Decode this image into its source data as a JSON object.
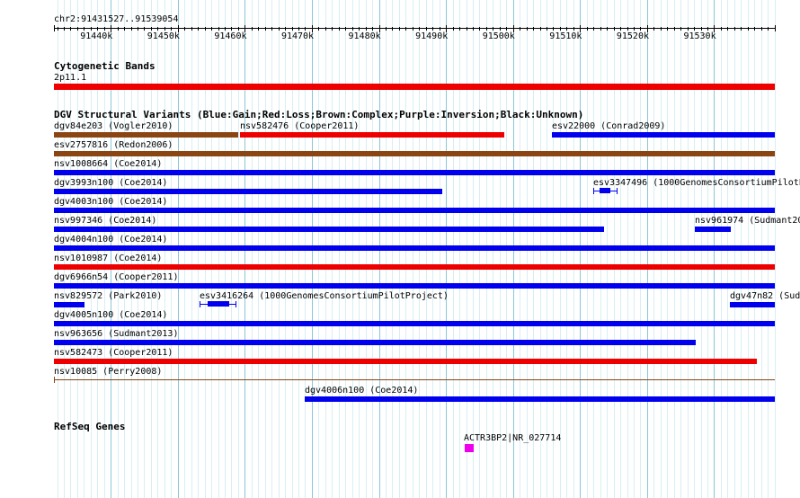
{
  "ruler": {
    "region": "chr2:91431527..91539054",
    "start": 91431527,
    "end": 91539054,
    "tick_labels": [
      "91440k",
      "91450k",
      "91460k",
      "91470k",
      "91480k",
      "91490k",
      "91500k",
      "91510k",
      "91520k",
      "91530k"
    ]
  },
  "colors": {
    "gain": "#0000ee",
    "loss": "#ee0000",
    "complex": "#8b4513",
    "unknown": "#000000",
    "band": "#ee0000",
    "gene": "#ee00ee",
    "major_grid": "#88c8d8",
    "minor_grid": "#d8eef4"
  },
  "tracks": {
    "cyto": {
      "title": "Cytogenetic Bands",
      "band_label": "2p11.1"
    },
    "dgv": {
      "title": "DGV Structural Variants (Blue:Gain;Red:Loss;Brown:Complex;Purple:Inversion;Black:Unknown)",
      "features": [
        {
          "label": "dgv84e203 (Vogler2010)",
          "color": "complex"
        },
        {
          "label": "nsv582476 (Cooper2011)",
          "color": "loss"
        },
        {
          "label": "esv22000 (Conrad2009)",
          "color": "gain"
        },
        {
          "label": "esv2757816 (Redon2006)",
          "color": "complex"
        },
        {
          "label": "nsv1008664 (Coe2014)",
          "color": "gain"
        },
        {
          "label": "dgv3993n100 (Coe2014)",
          "color": "gain"
        },
        {
          "label": "esv3347496 (1000GenomesConsortiumPilotP",
          "color": "gain"
        },
        {
          "label": "dgv4003n100 (Coe2014)",
          "color": "gain"
        },
        {
          "label": "nsv997346 (Coe2014)",
          "color": "gain"
        },
        {
          "label": "nsv961974 (Sudmant20",
          "color": "gain"
        },
        {
          "label": "dgv4004n100 (Coe2014)",
          "color": "gain"
        },
        {
          "label": "nsv1010987 (Coe2014)",
          "color": "loss"
        },
        {
          "label": "dgv6966n54 (Cooper2011)",
          "color": "gain"
        },
        {
          "label": "nsv829572 (Park2010)",
          "color": "gain"
        },
        {
          "label": "esv3416264 (1000GenomesConsortiumPilotProject)",
          "color": "gain"
        },
        {
          "label": "dgv47n82 (Sud",
          "color": "gain"
        },
        {
          "label": "dgv4005n100 (Coe2014)",
          "color": "gain"
        },
        {
          "label": "nsv963656 (Sudmant2013)",
          "color": "gain"
        },
        {
          "label": "nsv582473 (Cooper2011)",
          "color": "loss"
        },
        {
          "label": "nsv10085 (Perry2008)",
          "color": "complex"
        },
        {
          "label": "dgv4006n100 (Coe2014)",
          "color": "gain"
        }
      ]
    },
    "refseq": {
      "title": "RefSeq Genes",
      "gene_label": "ACTR3BP2|NR_027714"
    }
  }
}
